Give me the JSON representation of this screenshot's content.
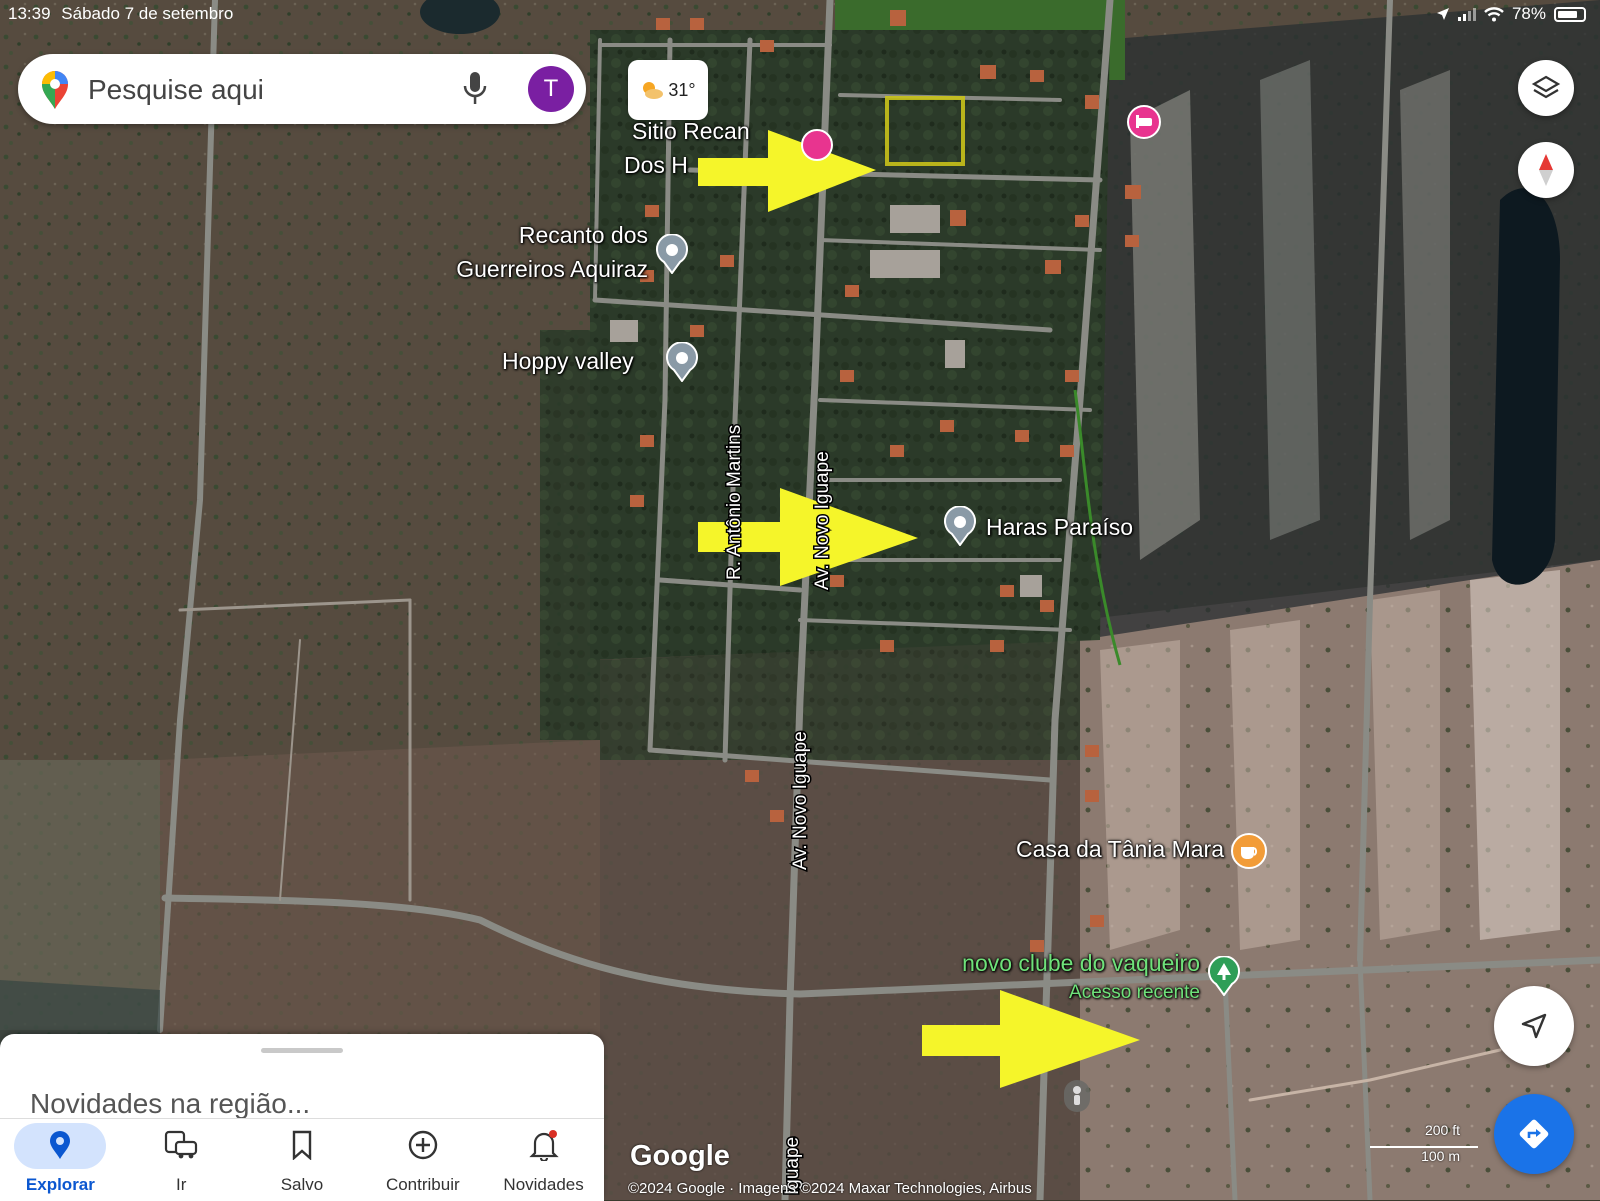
{
  "status_bar": {
    "time": "13:39",
    "date": "Sábado 7 de setembro",
    "battery": "78%"
  },
  "search": {
    "placeholder": "Pesquise aqui",
    "avatar_initial": "T"
  },
  "weather": {
    "temperature": "31°"
  },
  "map": {
    "labels": {
      "sitio_line1": "Sitio Recan",
      "sitio_line2": "Dos H",
      "recanto_line1": "Recanto dos",
      "recanto_line2": "Guerreiros Aquiraz",
      "hoppy": "Hoppy valley",
      "haras": "Haras Paraíso",
      "casa": "Casa da Tânia Mara",
      "clube": "novo clube do vaqueiro",
      "acesso": "Acesso recente",
      "rua_antonio": "R. Antônio Martins",
      "av_novo_iguape_upper": "Av. Novo Iguape",
      "av_novo_iguape_lower": "Av. Novo Iguape",
      "av_iguape_bottom": "Iguape"
    },
    "google_logo": "Google",
    "copyright": "©2024 Google · Imagens ©2024 Maxar Technologies, Airbus",
    "scale_upper": "200 ft",
    "scale_lower": "100 m"
  },
  "sheet": {
    "title": "Novidades na região..."
  },
  "bottom_nav": [
    {
      "label": "Explorar",
      "icon": "location-pin-icon",
      "active": true
    },
    {
      "label": "Ir",
      "icon": "car-bus-icon",
      "active": false
    },
    {
      "label": "Salvo",
      "icon": "bookmark-icon",
      "active": false
    },
    {
      "label": "Contribuir",
      "icon": "plus-circle-icon",
      "active": false
    },
    {
      "label": "Novidades",
      "icon": "bell-icon",
      "active": false
    }
  ],
  "colors": {
    "accent_blue": "#1a73e8",
    "arrow_yellow": "#f5f52a",
    "avatar_purple": "#7a1fa2",
    "poi_pink": "#e8348f",
    "poi_gray": "#8a9aa6",
    "poi_green": "#2e9e57",
    "poi_orange": "#f29c38"
  }
}
